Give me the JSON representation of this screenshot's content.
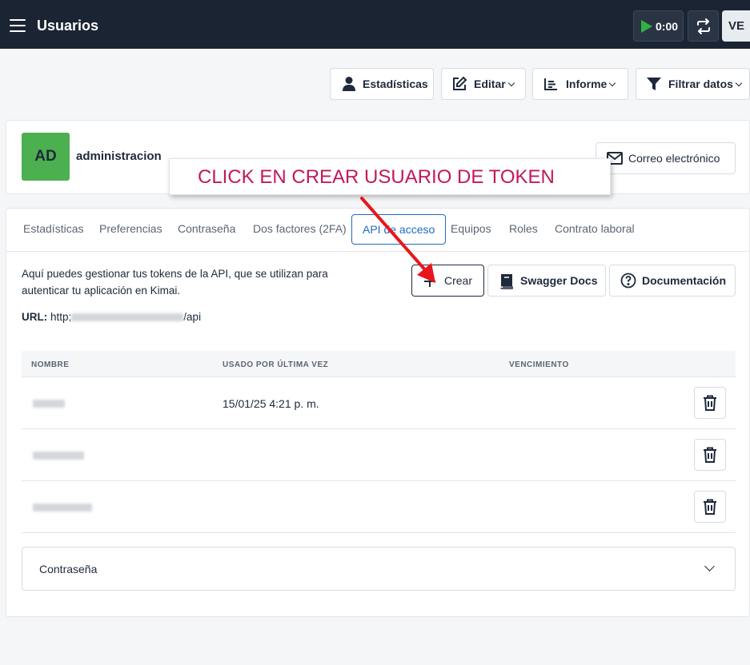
{
  "topbar": {
    "title": "Usuarios",
    "timer": "0:00",
    "user_initials": "VE"
  },
  "actions": {
    "stats": "Estadísticas",
    "edit": "Editar",
    "report": "Informe",
    "filter": "Filtrar datos"
  },
  "user": {
    "initials": "AD",
    "name": "administracion",
    "email_button": "Correo electrónico"
  },
  "annotation": {
    "text": "CLICK EN CREAR USUARIO DE TOKEN",
    "color": "#c2185b",
    "arrow_color": "#e8161b"
  },
  "tabs": [
    {
      "label": "Estadísticas",
      "active": false
    },
    {
      "label": "Preferencias",
      "active": false
    },
    {
      "label": "Contraseña",
      "active": false
    },
    {
      "label": "Dos factores (2FA)",
      "active": false
    },
    {
      "label": "API de acceso",
      "active": true
    },
    {
      "label": "Equipos",
      "active": false
    },
    {
      "label": "Roles",
      "active": false
    },
    {
      "label": "Contrato laboral",
      "active": false
    }
  ],
  "api": {
    "description": "Aquí puedes gestionar tus tokens de la API, que se utilizan para autenticar tu aplicación en Kimai.",
    "url_label": "URL:",
    "url_prefix": "http;",
    "url_suffix": "/api",
    "create_button": "Crear",
    "swagger_button": "Swagger Docs",
    "docs_button": "Documentación"
  },
  "table": {
    "columns": [
      "NOMBRE",
      "USADO POR ÚLTIMA VEZ",
      "VENCIMIENTO"
    ],
    "rows": [
      {
        "last_used": "15/01/25 4:21 p. m.",
        "expires": ""
      },
      {
        "last_used": "",
        "expires": ""
      },
      {
        "last_used": "",
        "expires": ""
      }
    ]
  },
  "accordion": {
    "label": "Contraseña"
  },
  "colors": {
    "topbar": "#1b2432",
    "accent": "#206bc4",
    "badge": "#4caf50",
    "play": "#2fb344"
  }
}
